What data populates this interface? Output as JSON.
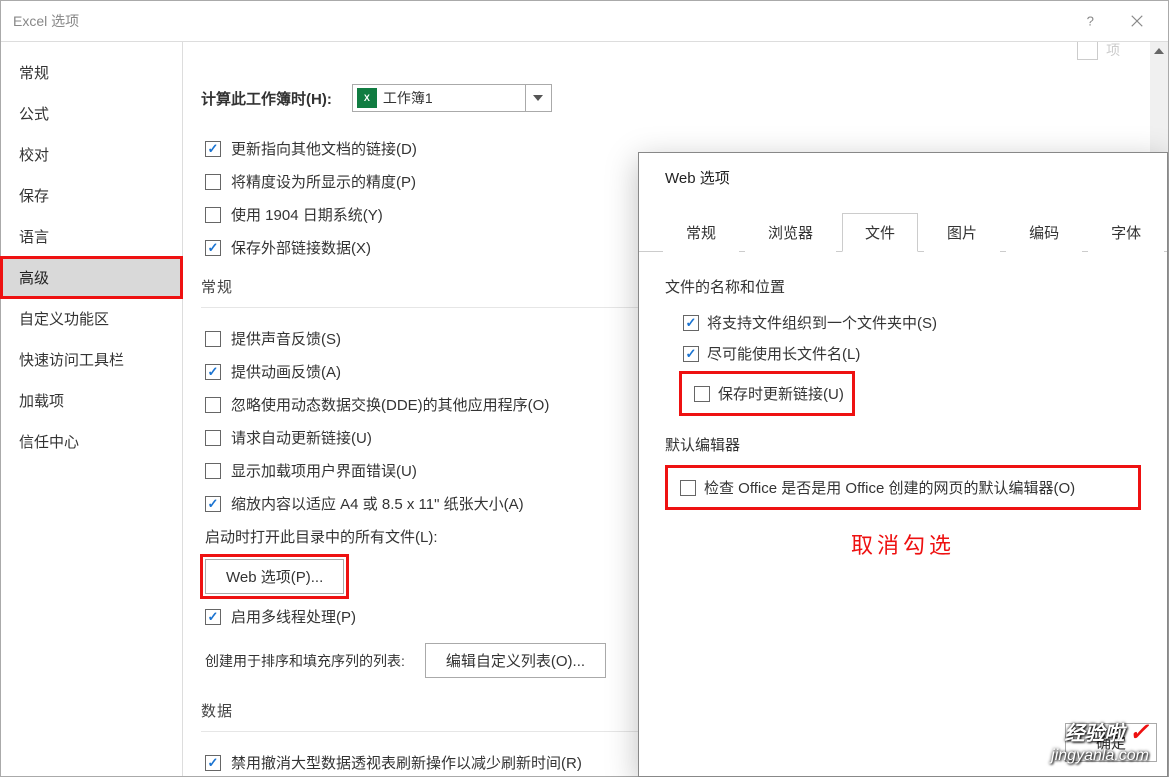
{
  "window": {
    "title": "Excel 选项",
    "help_tooltip": "?",
    "close_tooltip": "×"
  },
  "sidebar": {
    "items": [
      {
        "label": "常规"
      },
      {
        "label": "公式"
      },
      {
        "label": "校对"
      },
      {
        "label": "保存"
      },
      {
        "label": "语言"
      },
      {
        "label": "高级",
        "active": true,
        "highlight": true
      },
      {
        "label": "自定义功能区"
      },
      {
        "label": "快速访问工具栏"
      },
      {
        "label": "加载项"
      },
      {
        "label": "信任中心"
      }
    ]
  },
  "truncated": {
    "text": "选项"
  },
  "workbookCalc": {
    "label": "计算此工作簿时(H):",
    "selected": "工作簿1",
    "icon_text": "X",
    "checkboxes": [
      {
        "checked": true,
        "label": "更新指向其他文档的链接(D)"
      },
      {
        "checked": false,
        "label": "将精度设为所显示的精度(P)"
      },
      {
        "checked": false,
        "label": "使用 1904 日期系统(Y)"
      },
      {
        "checked": true,
        "label": "保存外部链接数据(X)"
      }
    ]
  },
  "generalSection": {
    "heading": "常规",
    "checkboxes": [
      {
        "checked": false,
        "label": "提供声音反馈(S)"
      },
      {
        "checked": true,
        "label": "提供动画反馈(A)"
      },
      {
        "checked": false,
        "label": "忽略使用动态数据交换(DDE)的其他应用程序(O)"
      },
      {
        "checked": false,
        "label": "请求自动更新链接(U)"
      },
      {
        "checked": false,
        "label": "显示加载项用户界面错误(U)"
      },
      {
        "checked": true,
        "label": "缩放内容以适应 A4 或 8.5 x 11\" 纸张大小(A)"
      }
    ],
    "startup_label": "启动时打开此目录中的所有文件(L):",
    "web_options_btn": "Web 选项(P)...",
    "multithread": {
      "checked": true,
      "label": "启用多线程处理(P)"
    },
    "custom_list_label": "创建用于排序和填充序列的列表:",
    "custom_list_btn": "编辑自定义列表(O)..."
  },
  "dataSection": {
    "heading": "数据",
    "checkbox": {
      "checked": true,
      "label": "禁用撤消大型数据透视表刷新操作以减少刷新时间(R)"
    }
  },
  "webDialog": {
    "title": "Web 选项",
    "tabs": [
      "常规",
      "浏览器",
      "文件",
      "图片",
      "编码",
      "字体"
    ],
    "activeTab": "文件",
    "group1_title": "文件的名称和位置",
    "group1_checkboxes": [
      {
        "checked": true,
        "label": "将支持文件组织到一个文件夹中(S)"
      },
      {
        "checked": true,
        "label": "尽可能使用长文件名(L)"
      },
      {
        "checked": false,
        "label": "保存时更新链接(U)",
        "boxed": true
      }
    ],
    "group2_title": "默认编辑器",
    "group2_checkbox": {
      "checked": false,
      "label": "检查 Office 是否是用 Office 创建的网页的默认编辑器(O)",
      "boxed": true
    },
    "annotation": "取消勾选",
    "ok_btn": "确定"
  },
  "watermark": {
    "line1": "经验啦",
    "line2": "jingyanla.com",
    "check": "✓"
  }
}
